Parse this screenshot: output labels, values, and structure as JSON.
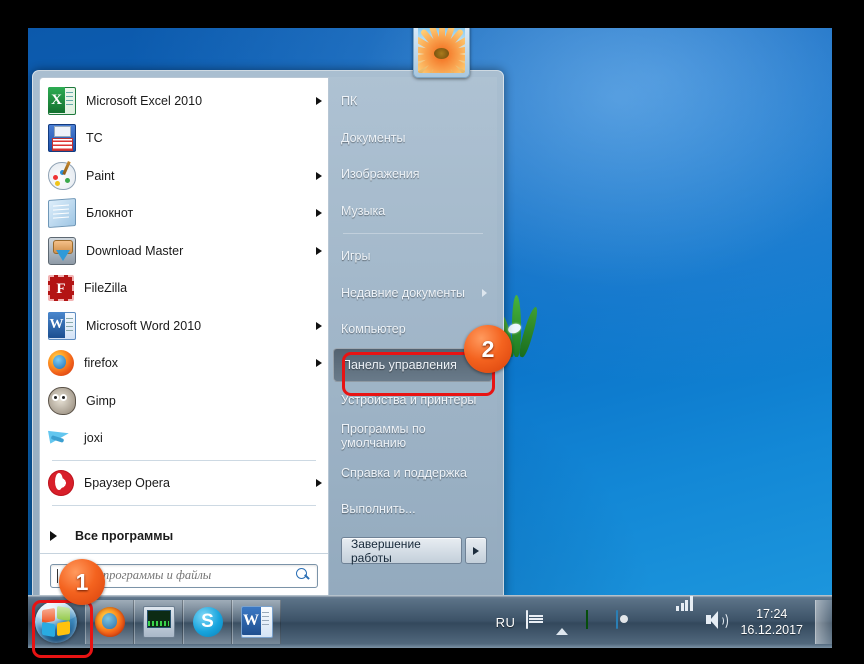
{
  "desktop": {
    "wallpaper_hint": "windows7-blue"
  },
  "start_menu": {
    "avatar": "sunflower-user-picture",
    "programs": [
      {
        "label": "Microsoft Excel 2010",
        "icon": "excel-icon",
        "has_submenu": true
      },
      {
        "label": "TC",
        "icon": "total-commander-icon",
        "has_submenu": false
      },
      {
        "label": "Paint",
        "icon": "paint-icon",
        "has_submenu": true
      },
      {
        "label": "Блокнот",
        "icon": "notepad-icon",
        "has_submenu": true
      },
      {
        "label": "Download Master",
        "icon": "download-master-icon",
        "has_submenu": true
      },
      {
        "label": "FileZilla",
        "icon": "filezilla-icon",
        "has_submenu": false
      },
      {
        "label": "Microsoft Word 2010",
        "icon": "word-icon",
        "has_submenu": true
      },
      {
        "label": "firefox",
        "icon": "firefox-icon",
        "has_submenu": true
      },
      {
        "label": "Gimp",
        "icon": "gimp-icon",
        "has_submenu": false
      },
      {
        "label": "joxi",
        "icon": "joxi-icon",
        "has_submenu": false
      },
      {
        "label": "Браузер Opera",
        "icon": "opera-icon",
        "has_submenu": true
      }
    ],
    "all_programs_label": "Все программы",
    "search": {
      "placeholder": "Найти программы и файлы",
      "value": "",
      "icon": "search-icon"
    },
    "right_items": [
      {
        "label": "ПК",
        "has_submenu": false,
        "highlight": false
      },
      {
        "label": "Документы",
        "has_submenu": false,
        "highlight": false
      },
      {
        "label": "Изображения",
        "has_submenu": false,
        "highlight": false
      },
      {
        "label": "Музыка",
        "has_submenu": false,
        "highlight": false
      },
      {
        "label": "Игры",
        "has_submenu": false,
        "highlight": false
      },
      {
        "label": "Недавние документы",
        "has_submenu": true,
        "highlight": false
      },
      {
        "label": "Компьютер",
        "has_submenu": false,
        "highlight": false
      },
      {
        "label": "Панель управления",
        "has_submenu": false,
        "highlight": true
      },
      {
        "label": "Устройства и принтеры",
        "has_submenu": false,
        "highlight": false
      },
      {
        "label": "Программы по умолчанию",
        "has_submenu": false,
        "highlight": false
      },
      {
        "label": "Справка и поддержка",
        "has_submenu": false,
        "highlight": false
      },
      {
        "label": "Выполнить...",
        "has_submenu": false,
        "highlight": false
      }
    ],
    "shutdown": {
      "label": "Завершение работы",
      "more_icon": "chevron-right-icon"
    }
  },
  "taskbar": {
    "start_button": "start-orb",
    "buttons": [
      {
        "name": "firefox",
        "icon": "firefox-icon"
      },
      {
        "name": "performance-monitor",
        "icon": "monitor-icon"
      },
      {
        "name": "skype",
        "icon": "skype-icon",
        "glyph": "S"
      },
      {
        "name": "word",
        "icon": "word-icon"
      }
    ],
    "tray": {
      "language": "RU",
      "icons": [
        "keyboard-icon",
        "show-hidden-icons-arrow",
        "green-grid-icon",
        "note-icon",
        "avast-icon",
        "network-signal-icon",
        "volume-icon"
      ],
      "time": "17:24",
      "date": "16.12.2017"
    },
    "show_desktop": "show-desktop-button"
  },
  "callouts": [
    {
      "number": "1",
      "target": "start-button",
      "color": "#f4631f"
    },
    {
      "number": "2",
      "target": "control-panel-item",
      "color": "#f4631f"
    }
  ]
}
